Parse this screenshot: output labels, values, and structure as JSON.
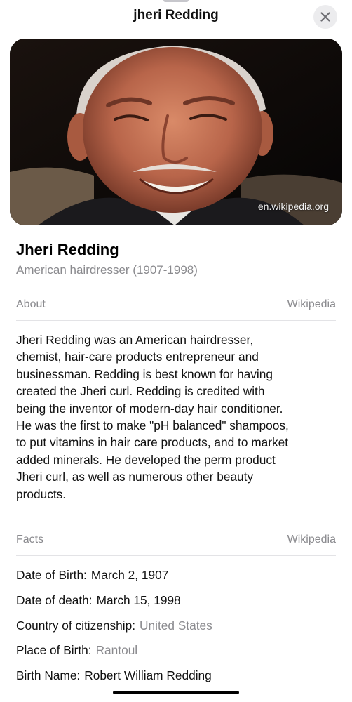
{
  "header": {
    "title": "jheri Redding",
    "close_icon": "close-icon"
  },
  "hero": {
    "source": "en.wikipedia.org"
  },
  "entity": {
    "name": "Jheri Redding",
    "description": "American hairdresser (1907-1998)"
  },
  "about": {
    "label": "About",
    "source": "Wikipedia",
    "lines": [
      "Jheri Redding was an American hairdresser,",
      "chemist, hair-care products entrepreneur and",
      "businessman. Redding is best known for having",
      "created the Jheri curl. Redding is credited with",
      "being the inventor of modern-day hair conditioner.",
      "He was the first to make \"pH balanced\" shampoos,",
      "to put vitamins in hair care products, and to market",
      "added minerals. He developed the perm product",
      "Jheri curl, as well as numerous other beauty",
      "products."
    ]
  },
  "facts": {
    "label": "Facts",
    "source": "Wikipedia",
    "items": [
      {
        "label": "Date of Birth:",
        "value": "March 2, 1907",
        "link": false
      },
      {
        "label": "Date of death:",
        "value": "March 15, 1998",
        "link": false
      },
      {
        "label": "Country of citizenship:",
        "value": "United States",
        "link": true
      },
      {
        "label": "Place of Birth:",
        "value": "Rantoul",
        "link": true
      },
      {
        "label": "Birth Name:",
        "value": "Robert William Redding",
        "link": false
      }
    ]
  },
  "colors": {
    "secondary_text": "#8a8a8e",
    "close_button_bg": "#ececee"
  }
}
